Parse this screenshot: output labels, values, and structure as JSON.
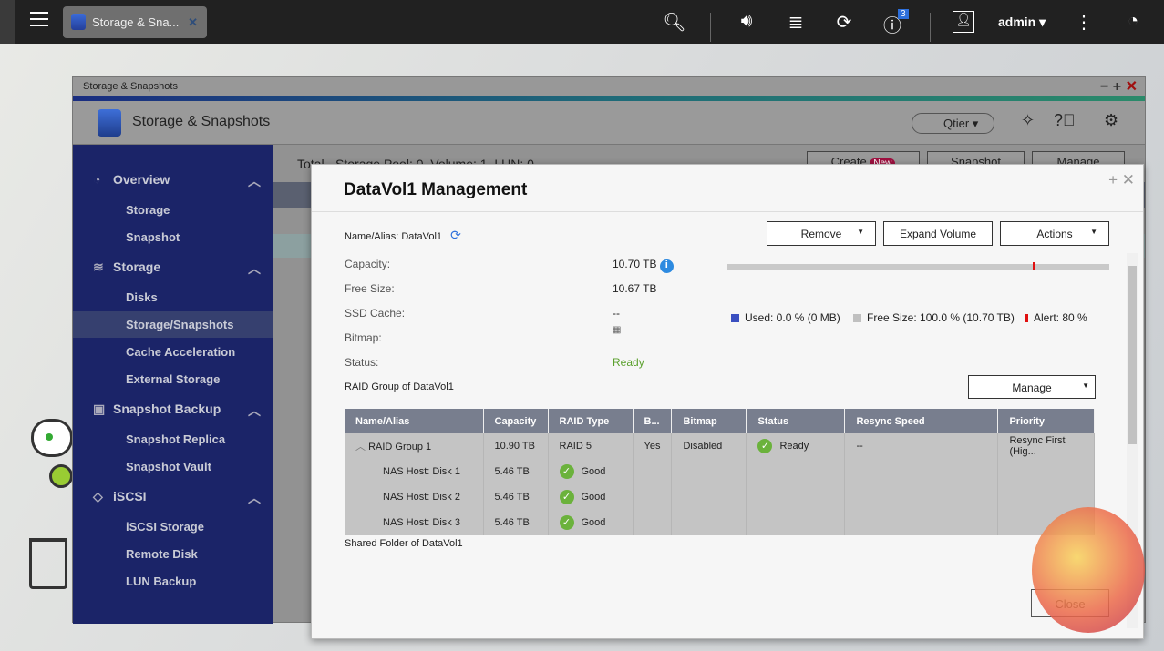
{
  "topbar": {
    "app_tab": "Storage & Sna...",
    "notification_count": "3",
    "user": "admin"
  },
  "window": {
    "title": "Storage & Snapshots",
    "header_title": "Storage & Snapshots",
    "qtier": "Qtier"
  },
  "sidebar": {
    "sections": [
      {
        "label": "Overview",
        "items": [
          "Storage",
          "Snapshot"
        ]
      },
      {
        "label": "Storage",
        "items": [
          "Disks",
          "Storage/Snapshots",
          "Cache Acceleration",
          "External Storage"
        ]
      },
      {
        "label": "Snapshot Backup",
        "items": [
          "Snapshot Replica",
          "Snapshot Vault"
        ]
      },
      {
        "label": "iSCSI",
        "items": [
          "iSCSI Storage",
          "Remote Disk",
          "LUN Backup"
        ]
      }
    ],
    "selected": "Storage/Snapshots"
  },
  "main": {
    "total": "Total - Storage Pool: 0, Volume: 1, LUN: 0",
    "create": "Create",
    "new_badge": "New",
    "snapshot": "Snapshot",
    "manage": "Manage"
  },
  "modal": {
    "title": "DataVol1  Management",
    "name_label": "Name/Alias:",
    "name_value": "DataVol1",
    "buttons": {
      "remove": "Remove",
      "expand": "Expand Volume",
      "actions": "Actions",
      "manage": "Manage",
      "close": "Close"
    },
    "fields": [
      {
        "label": "Capacity:",
        "value": "10.70 TB"
      },
      {
        "label": "Free Size:",
        "value": "10.67 TB"
      },
      {
        "label": "SSD Cache:",
        "value": "--"
      },
      {
        "label": "Bitmap:",
        "value": ""
      },
      {
        "label": "Status:",
        "value": "Ready"
      }
    ],
    "usage": {
      "used_percent": 0.0,
      "alert_percent": 80,
      "used": "Used: 0.0 % (0 MB)",
      "free": "Free Size: 100.0 % (10.70 TB)",
      "alert": "Alert: 80 %",
      "colors": {
        "used": "#3a4fc0",
        "free": "#c0c0c0",
        "alert": "#e01010"
      }
    },
    "raid_title": "RAID Group of DataVol1",
    "shared_title": "Shared Folder of DataVol1",
    "table": {
      "headers": [
        "Name/Alias",
        "Capacity",
        "RAID Type",
        "B...",
        "Bitmap",
        "Status",
        "Resync Speed",
        "Priority"
      ],
      "group": [
        "RAID Group 1",
        "10.90 TB",
        "RAID 5",
        "Yes",
        "Disabled",
        "Ready",
        "--",
        "Resync First (Hig..."
      ],
      "disks": [
        {
          "name": "NAS Host: Disk 1",
          "capacity": "5.46 TB",
          "status": "Good"
        },
        {
          "name": "NAS Host: Disk 2",
          "capacity": "5.46 TB",
          "status": "Good"
        },
        {
          "name": "NAS Host: Disk 3",
          "capacity": "5.46 TB",
          "status": "Good"
        }
      ]
    }
  }
}
